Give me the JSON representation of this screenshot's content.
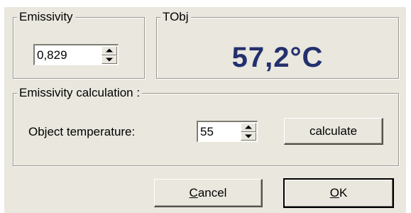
{
  "emissivity": {
    "legend": "Emissivity",
    "value": "0,829"
  },
  "tobj": {
    "legend": "TObj",
    "reading": "57,2°C",
    "color": "#23306d"
  },
  "calculation": {
    "legend": "Emissivity calculation :",
    "object_temperature_label": "Object temperature:",
    "object_temperature_value": "55",
    "calculate_label": "calculate"
  },
  "footer": {
    "cancel_mnemonic": "C",
    "cancel_rest": "ancel",
    "ok_mnemonic": "O",
    "ok_rest": "K"
  }
}
